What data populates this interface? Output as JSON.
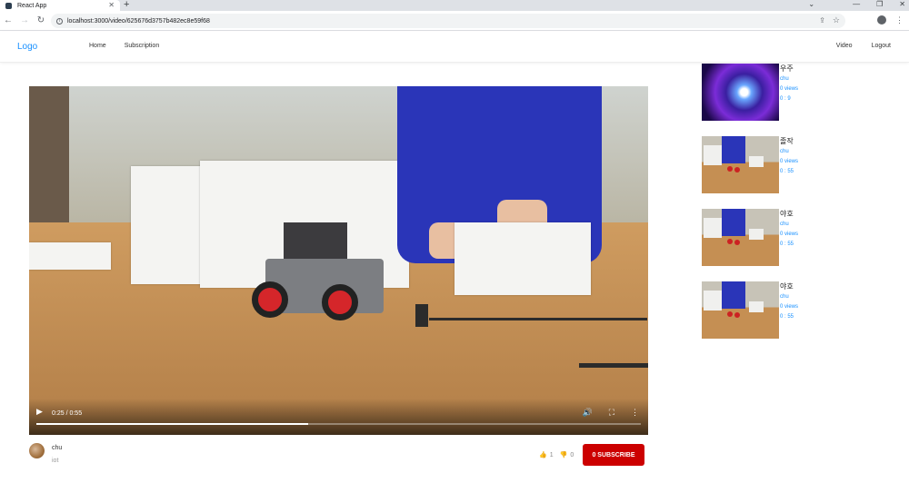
{
  "browser": {
    "tab_title": "React App",
    "url": "localhost:3000/video/625676d3757b482ec8e59f68"
  },
  "header": {
    "logo": "Logo",
    "menu_left": [
      "Home",
      "Subscription"
    ],
    "menu_right": [
      "Video",
      "Logout"
    ]
  },
  "video": {
    "time": "0:25 / 0:55",
    "progress": 0.45
  },
  "details": {
    "uploader": "chu",
    "description": "iot",
    "like_count": "1",
    "dislike_count": "0",
    "subscribe_label": "0 SUBSCRIBE"
  },
  "sidebar": {
    "items": [
      {
        "title": "우주",
        "channel": "chu",
        "views": "0 views",
        "duration": "0 : 9",
        "thumb": "space"
      },
      {
        "title": "졸작",
        "channel": "chu",
        "views": "0 views",
        "duration": "0 : 55",
        "thumb": "robot"
      },
      {
        "title": "야호",
        "channel": "chu",
        "views": "0 views",
        "duration": "0 : 55",
        "thumb": "robot"
      },
      {
        "title": "야호",
        "channel": "chu",
        "views": "0 views",
        "duration": "0 : 55",
        "thumb": "robot"
      }
    ]
  },
  "colors": {
    "accent": "#1890ff",
    "subscribe": "#cc0000"
  }
}
